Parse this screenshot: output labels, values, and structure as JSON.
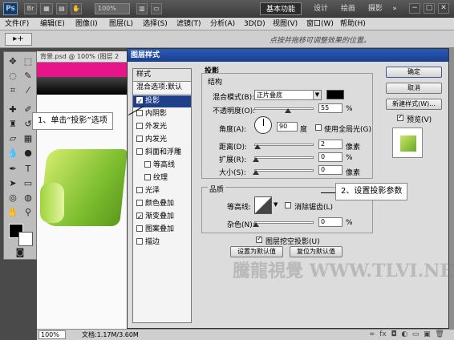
{
  "titlebar": {
    "app_logo": "Ps",
    "zoom": "100%",
    "workspaces": [
      "基本功能",
      "设计",
      "绘画",
      "摄影"
    ],
    "more": "»",
    "window_controls": [
      "−",
      "□",
      "✕"
    ]
  },
  "menu": [
    "文件(F)",
    "编辑(E)",
    "图像(I)",
    "图层(L)",
    "选择(S)",
    "滤镜(T)",
    "分析(A)",
    "3D(D)",
    "视图(V)",
    "窗口(W)",
    "帮助(H)"
  ],
  "options": {
    "tool": "▸+",
    "hint": "点按并拖移可调整效果的位置。"
  },
  "document": {
    "tab": "背景.psd @ 100% (图层 2"
  },
  "status": {
    "zoom": "100%",
    "doc_size": "文档:1.17M/3.60M"
  },
  "dialog": {
    "title": "图层样式",
    "styles_header": "样式",
    "blend_options": "混合选项:默认",
    "styles": [
      {
        "label": "投影",
        "checked": true,
        "selected": true
      },
      {
        "label": "内阴影",
        "checked": false
      },
      {
        "label": "外发光",
        "checked": false
      },
      {
        "label": "内发光",
        "checked": false
      },
      {
        "label": "斜面和浮雕",
        "checked": false
      },
      {
        "label": "等高线",
        "checked": false
      },
      {
        "label": "纹理",
        "checked": false
      },
      {
        "label": "光泽",
        "checked": false
      },
      {
        "label": "颜色叠加",
        "checked": false
      },
      {
        "label": "渐变叠加",
        "checked": true
      },
      {
        "label": "图案叠加",
        "checked": false
      },
      {
        "label": "描边",
        "checked": false
      }
    ],
    "section_title": "投影",
    "structure_title": "结构",
    "blend_mode_label": "混合模式(B):",
    "blend_mode_value": "正片叠底",
    "opacity_label": "不透明度(O):",
    "opacity_value": "55",
    "percent": "%",
    "angle_label": "角度(A):",
    "angle_value": "90",
    "degree_unit": "度",
    "global_light_label": "使用全局光(G)",
    "distance_label": "距离(D):",
    "distance_value": "2",
    "spread_label": "扩展(R):",
    "spread_value": "0",
    "size_label": "大小(S):",
    "size_value": "0",
    "px_unit": "像素",
    "quality_title": "品质",
    "contour_label": "等高线:",
    "antialias_label": "消除锯齿(L)",
    "noise_label": "杂色(N):",
    "noise_value": "0",
    "knockout_label": "图层挖空投影(U)",
    "make_default": "设置为默认值",
    "reset_default": "复位为默认值",
    "ok": "确定",
    "cancel": "取消",
    "new_style": "新建样式(W)...",
    "preview_label": "预览(V)"
  },
  "callouts": {
    "step1": "1、单击“投影”选项",
    "step2": "2、设置投影参数"
  },
  "watermark": "騰龍視覺 WWW.TLVI.NET"
}
